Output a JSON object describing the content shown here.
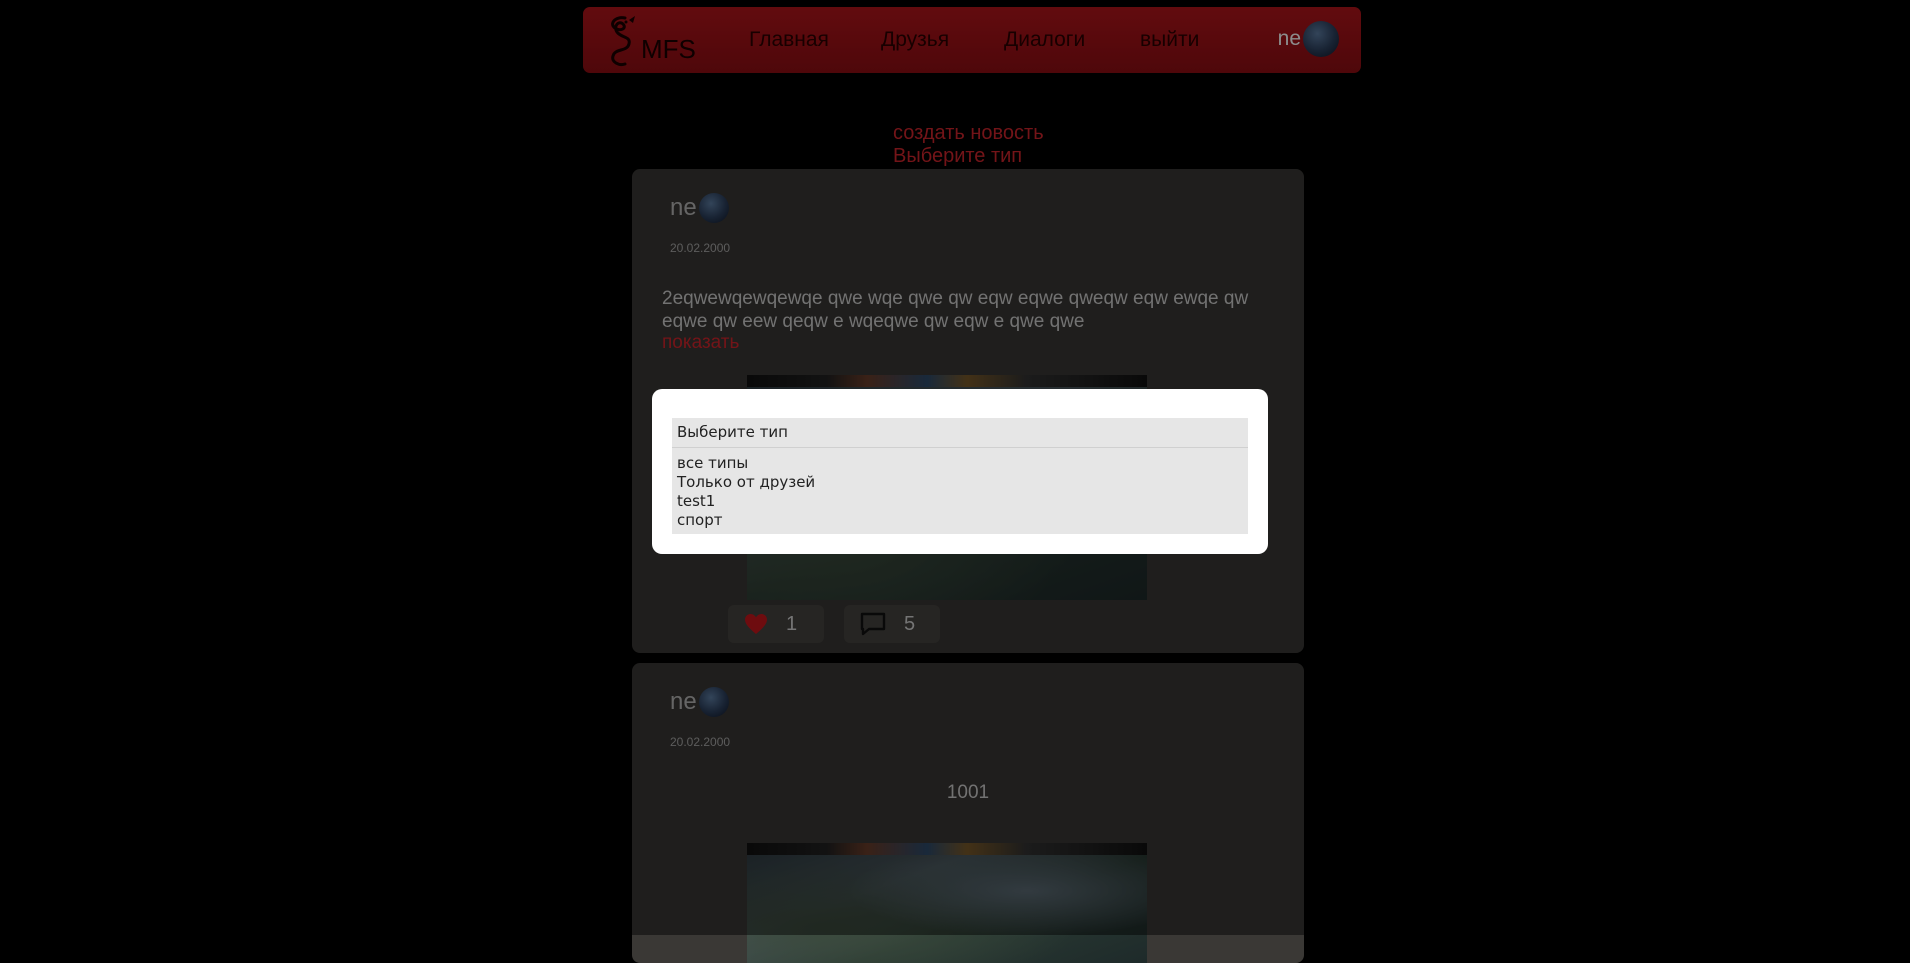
{
  "header": {
    "logo_text": "MFS",
    "nav": [
      {
        "label": "Главная"
      },
      {
        "label": "Друзья"
      },
      {
        "label": "Диалоги"
      },
      {
        "label": "выйти"
      }
    ],
    "user_name": "ne"
  },
  "actions": {
    "create_news": "создать новость",
    "choose_type": "Выберите тип"
  },
  "posts": [
    {
      "author": "ne",
      "date": "20.02.2000",
      "text": "2eqwewqewqewqe qwe wqe qwe qw eqw eqwe qweqw eqw ewqe qw eqwe qw eew qeqw e wqeqwe qw eqw e qwe qwe",
      "show_more": "показать",
      "likes": "1",
      "comments": "5"
    },
    {
      "author": "ne",
      "date": "20.02.2000",
      "text": "1001"
    }
  ],
  "modal": {
    "select_label": "Выберите тип",
    "options": [
      "все типы",
      "Только от друзей",
      "test1",
      "спорт"
    ]
  },
  "colors": {
    "accent": "#d1262d",
    "header_red": "#a81318",
    "card_bg": "#3a3835"
  }
}
